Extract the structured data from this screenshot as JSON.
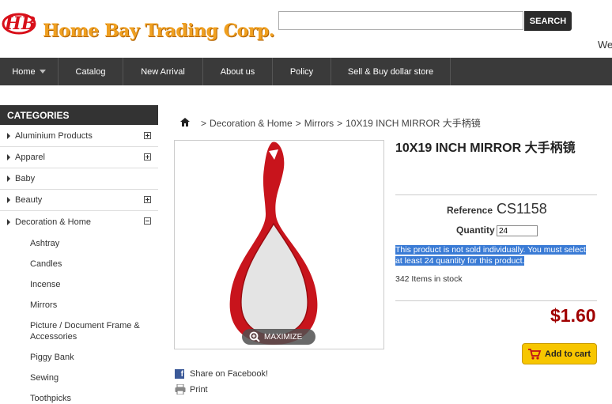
{
  "brand": {
    "logo_mark": "HB",
    "name": "Home Bay Trading Corp."
  },
  "search": {
    "placeholder": "",
    "button": "SEARCH"
  },
  "header": {
    "welcome": "We"
  },
  "nav": [
    "Home",
    "Catalog",
    "New Arrival",
    "About us",
    "Policy",
    "Sell & Buy dollar store"
  ],
  "sidebar": {
    "title": "CATEGORIES",
    "items": [
      {
        "label": "Aluminium Products",
        "toggle": "plus"
      },
      {
        "label": "Apparel",
        "toggle": "plus"
      },
      {
        "label": "Baby",
        "toggle": ""
      },
      {
        "label": "Beauty",
        "toggle": "plus"
      },
      {
        "label": "Decoration & Home",
        "toggle": "minus"
      }
    ],
    "subitems": [
      "Ashtray",
      "Candles",
      "Incense",
      "Mirrors",
      "Picture / Document Frame &",
      "Accessories",
      "Piggy Bank",
      "Sewing",
      "Toothpicks"
    ]
  },
  "breadcrumb": {
    "sep": ">",
    "items": [
      "Decoration & Home",
      "Mirrors",
      "10X19 INCH MIRROR 大手柄镜"
    ]
  },
  "product": {
    "title": "10X19 INCH MIRROR 大手柄镜",
    "reference_label": "Reference",
    "reference": "CS1158",
    "quantity_label": "Quantity",
    "quantity": "24",
    "notice_1": "This product is not sold individually. You must select",
    "notice_2": "at least 24 quantity for this product.",
    "stock": "342 Items in stock",
    "price": "$1.60",
    "add_to_cart": "Add to cart",
    "maximize": "MAXIMIZE",
    "mirror_color": "#c8141c"
  },
  "social": {
    "facebook": "Share on Facebook!",
    "print": "Print"
  },
  "colors": {
    "nav_bg": "#3a3a3a",
    "price": "#a00000",
    "cart_button": "#f7c600",
    "highlight": "#3a7bd5"
  }
}
